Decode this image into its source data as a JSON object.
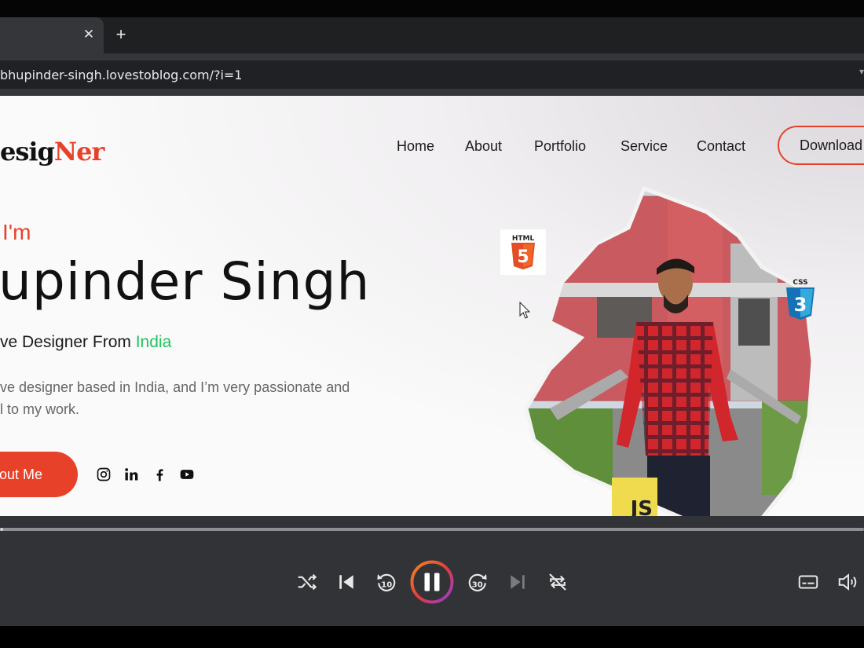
{
  "browser": {
    "tab_close_glyph": "✕",
    "new_tab_glyph": "+",
    "url": "bhupinder-singh.lovestoblog.com/?i=1"
  },
  "site": {
    "logo_main": "esig",
    "logo_accent": "Ner",
    "nav": [
      "Home",
      "About",
      "Portfolio",
      "Service",
      "Contact"
    ],
    "download_label": "Download",
    "greeting": "I'm",
    "name": "upinder Singh",
    "role_prefix": "ve Designer From ",
    "role_country": "India",
    "bio_line1": "ve designer based in India, and I’m very passionate and",
    "bio_line2": "l to my work.",
    "about_button": "out Me",
    "social_icons": [
      "instagram-icon",
      "linkedin-icon",
      "facebook-icon",
      "youtube-icon"
    ],
    "badges": {
      "html": "HTML",
      "html_num": "5",
      "css": "CSS",
      "css_num": "3",
      "js": "JS"
    },
    "colors": {
      "accent": "#e8412a",
      "green": "#22c35e"
    }
  },
  "player": {
    "progress": 0.003,
    "skip_back_seconds": "10",
    "skip_forward_seconds": "30",
    "state": "playing",
    "controls": [
      "shuffle-icon",
      "previous-icon",
      "skip-back-10-icon",
      "pause-icon",
      "skip-forward-30-icon",
      "next-icon",
      "repeat-off-icon",
      "captions-icon",
      "volume-icon"
    ]
  }
}
